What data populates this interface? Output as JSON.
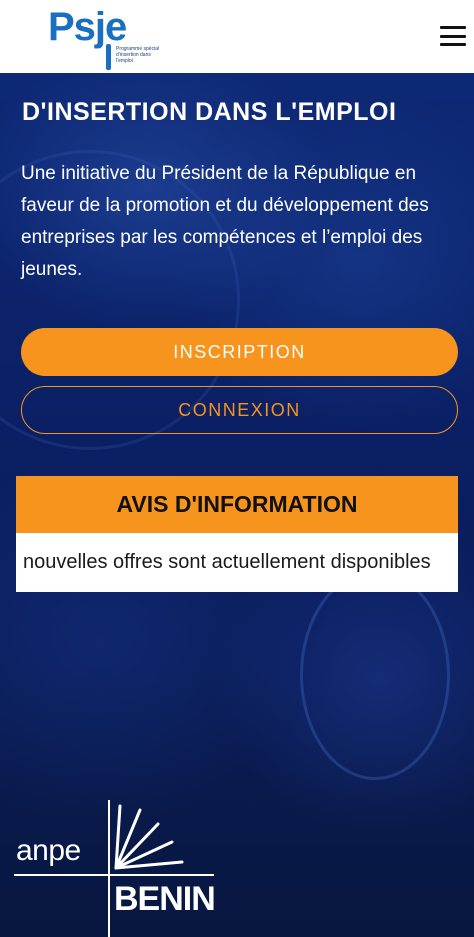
{
  "header": {
    "logo_word": "Psje",
    "logo_subtitle": "Programme spécial d'insertion dans l'emploi",
    "menu_icon": "hamburger-menu-icon"
  },
  "hero": {
    "title": "D'INSERTION DANS L'EMPLOI",
    "intro": "Une initiative du Président de la République en faveur de la promotion et du développement des entreprises par les compétences et l’emploi des jeunes."
  },
  "actions": {
    "inscription_label": "INSCRIPTION",
    "connexion_label": "CONNEXION"
  },
  "notice": {
    "heading": "AVIS D'INFORMATION",
    "ticker": "nouvelles offres sont actuellement disponibles"
  },
  "footer": {
    "anpe": "anpe",
    "benin": "BENIN"
  },
  "colors": {
    "accent": "#f7941d",
    "brand_blue": "#1a6fc0",
    "background": "#0b2167"
  }
}
